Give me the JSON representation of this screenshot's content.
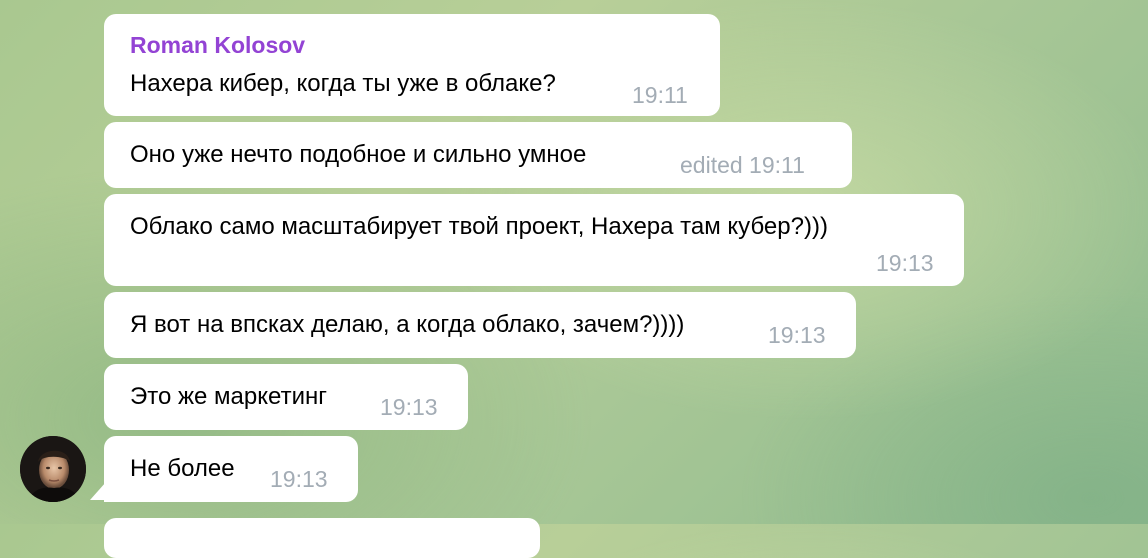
{
  "messages": [
    {
      "sender": "Roman Kolosov",
      "text": "Нахера кибер, когда ты уже в облаке?",
      "time": "19:11"
    },
    {
      "text": "Оно уже нечто подобное и сильно умное",
      "time": "edited 19:11"
    },
    {
      "text": "Облако само масштабирует твой проект, Нахера там кубер?)))",
      "time": "19:13"
    },
    {
      "text": "Я вот на впсках делаю, а когда облако, зачем?))))",
      "time": "19:13"
    },
    {
      "text": "Это же маркетинг",
      "time": "19:13"
    },
    {
      "text": "Не более",
      "time": "19:13"
    }
  ],
  "colors": {
    "sender_name": "#9343d4",
    "timestamp": "#a3acb5",
    "bubble": "#ffffff"
  },
  "icons": {
    "avatar": "user-avatar-photo"
  }
}
